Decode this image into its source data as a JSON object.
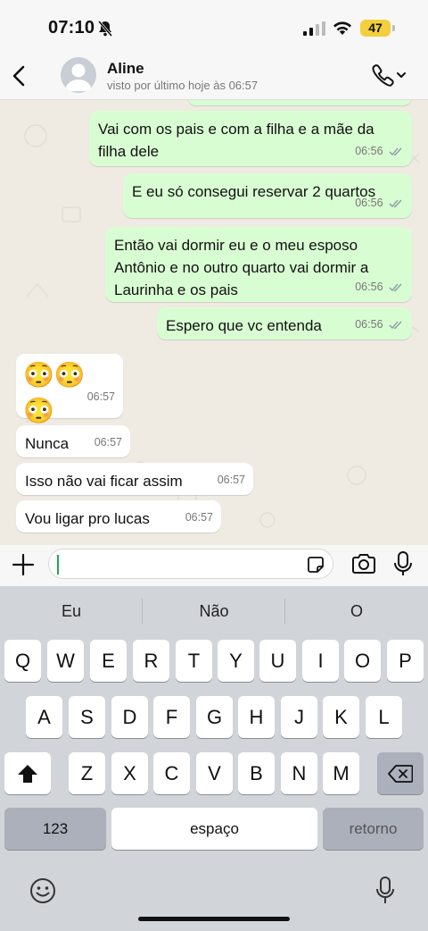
{
  "status_bar": {
    "time": "07:10",
    "battery": "47"
  },
  "header": {
    "contact_name": "Aline",
    "last_seen": "visto por último hoje às 06:57"
  },
  "messages": [
    {
      "text": "Vai com os pais e com a filha e a mãe da filha dele",
      "time": "06:56",
      "direction": "outgoing"
    },
    {
      "text": "E eu só consegui reservar 2 quartos",
      "time": "06:56",
      "direction": "outgoing"
    },
    {
      "text": "Então vai dormir eu e o meu esposo Antônio e no outro quarto vai dormir a Laurinha e os pais",
      "time": "06:56",
      "direction": "outgoing"
    },
    {
      "text": "Espero que vc entenda",
      "time": "06:56",
      "direction": "outgoing"
    },
    {
      "text": "😳😳😳",
      "time": "06:57",
      "direction": "incoming"
    },
    {
      "text": "Nunca",
      "time": "06:57",
      "direction": "incoming"
    },
    {
      "text": "Isso não vai ficar assim",
      "time": "06:57",
      "direction": "incoming"
    },
    {
      "text": "Vou ligar pro lucas",
      "time": "06:57",
      "direction": "incoming"
    }
  ],
  "composer": {
    "value": ""
  },
  "keyboard": {
    "suggestions": [
      "Eu",
      "Não",
      "O"
    ],
    "row1": [
      "Q",
      "W",
      "E",
      "R",
      "T",
      "Y",
      "U",
      "I",
      "O",
      "P"
    ],
    "row2": [
      "A",
      "S",
      "D",
      "F",
      "G",
      "H",
      "J",
      "K",
      "L"
    ],
    "row3": [
      "Z",
      "X",
      "C",
      "V",
      "B",
      "N",
      "M"
    ],
    "numbers_key": "123",
    "space_key": "espaço",
    "return_key": "retorno"
  },
  "colors": {
    "outgoing_bubble": "#d9fdd3",
    "incoming_bubble": "#ffffff",
    "read_ticks": "#8696a0",
    "accent": "#1fa855"
  }
}
